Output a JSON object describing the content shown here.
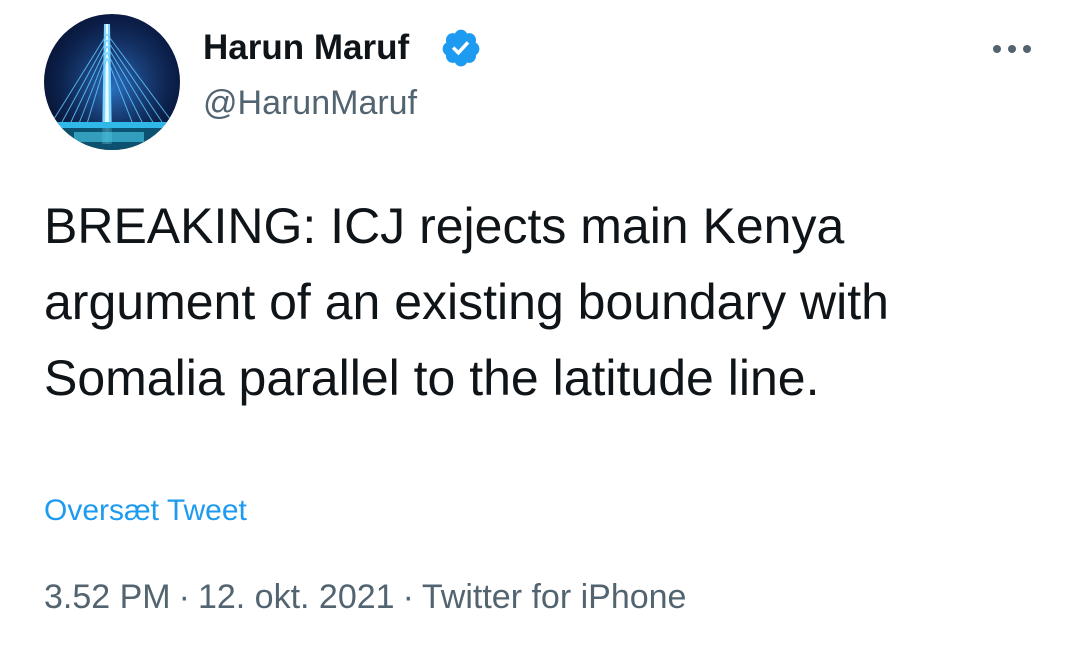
{
  "author": {
    "name": "Harun Maruf",
    "handle": "@HarunMaruf",
    "verified": true,
    "verified_color": "#1d9bf0"
  },
  "menu": {
    "icon": "more-horizontal-icon"
  },
  "tweet": {
    "text": "BREAKING: ICJ rejects main Kenya argument of an existing boundary with Somalia parallel to the latitude line.",
    "translate_label": "Oversæt Tweet",
    "time": "3.52 PM",
    "separator": "·",
    "date": "12. okt. 2021",
    "source": "Twitter for iPhone"
  },
  "colors": {
    "text": "#0f1419",
    "secondary": "#536471",
    "link": "#1d9bf0"
  }
}
